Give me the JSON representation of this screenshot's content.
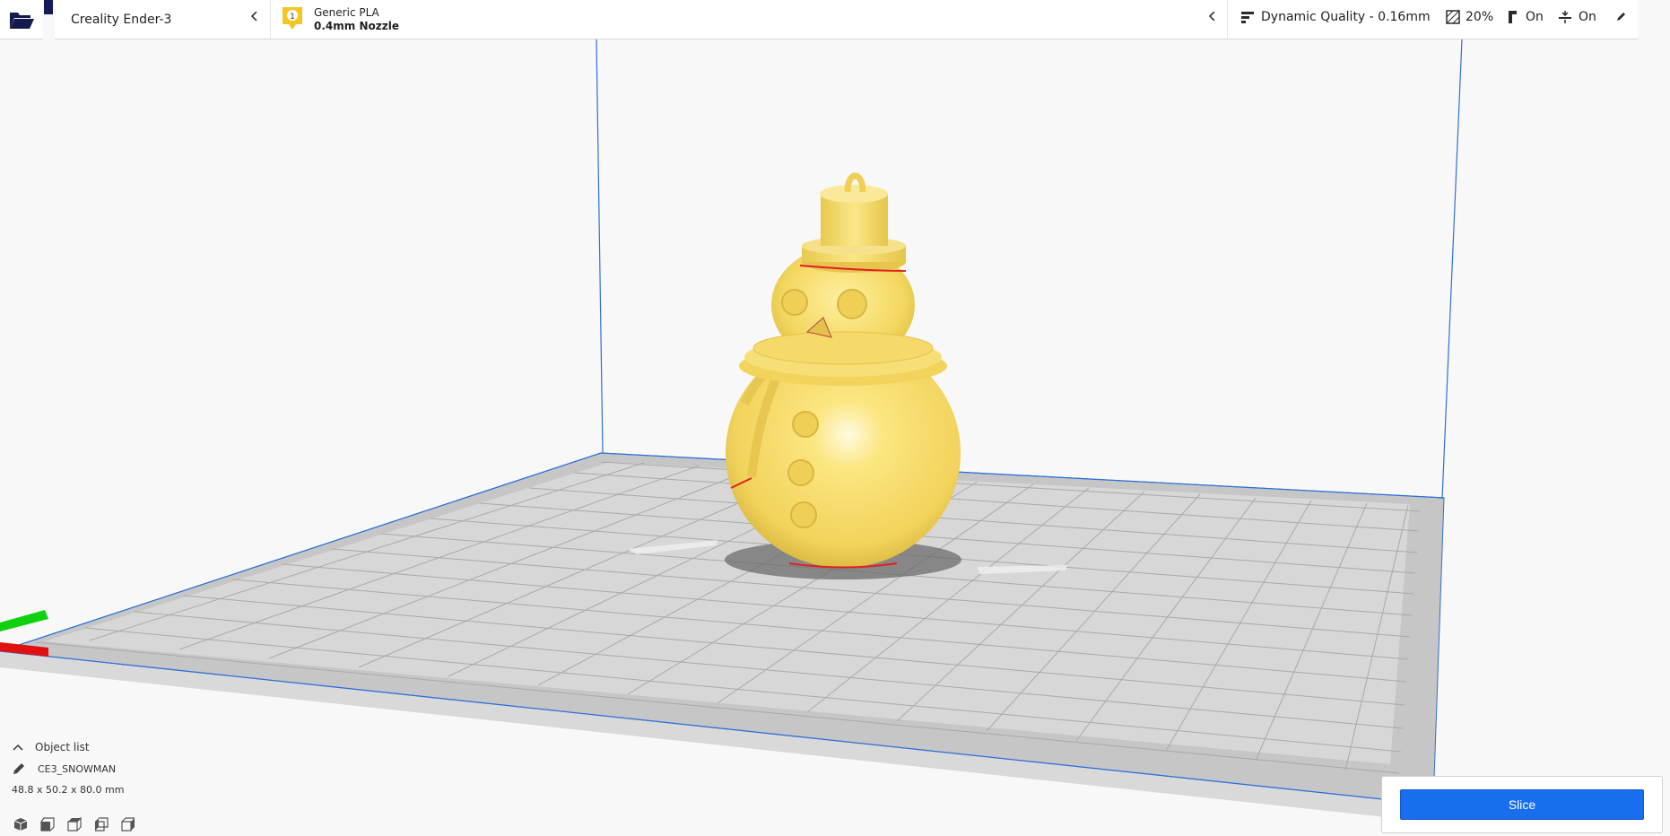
{
  "toolbar": {
    "open_icon": "folder-open-icon",
    "printer": {
      "name": "Creality Ender-3",
      "icon": "chevron-left-icon"
    },
    "material": {
      "extruder_number": "1",
      "name": "Generic PLA",
      "nozzle": "0.4mm Nozzle",
      "icon": "chevron-left-icon"
    },
    "print_settings": {
      "profile": "Dynamic Quality - 0.16mm",
      "infill": "20%",
      "support": "On",
      "adhesion": "On",
      "icons": [
        "profile-icon",
        "infill-icon",
        "support-icon",
        "adhesion-icon",
        "edit-pencil-icon"
      ]
    }
  },
  "scene": {
    "object_color": "#f7d96a",
    "build_plate_color": "#c8c8c8",
    "volume_edge_color": "#2d6fd8",
    "axis_colors": {
      "x": "#e01010",
      "y": "#10d010"
    }
  },
  "object_list": {
    "header": "Object list",
    "object_name": "CE3_SNOWMAN",
    "dimensions": "48.8 x 50.2 x 80.0 mm",
    "view_icons": [
      "view-3d-icon",
      "view-front-icon",
      "view-top-icon",
      "view-left-icon",
      "view-right-icon"
    ]
  },
  "slice": {
    "label": "Slice",
    "accent": "#196ef0"
  }
}
